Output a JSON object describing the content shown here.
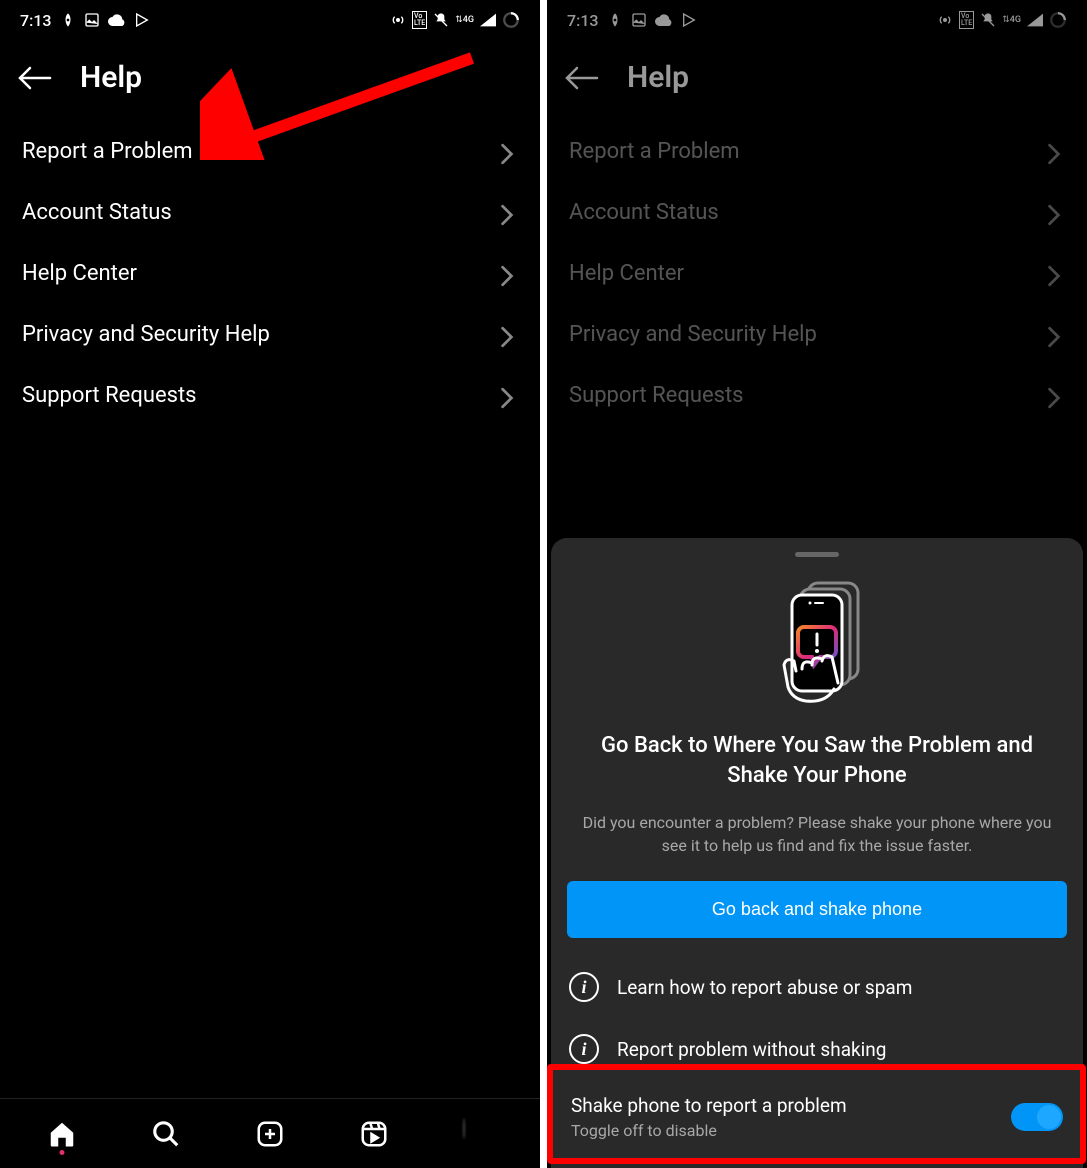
{
  "status": {
    "time": "7:13",
    "network_label": "4G"
  },
  "header": {
    "title": "Help"
  },
  "menu": {
    "items": [
      {
        "label": "Report a Problem"
      },
      {
        "label": "Account Status"
      },
      {
        "label": "Help Center"
      },
      {
        "label": "Privacy and Security Help"
      },
      {
        "label": "Support Requests"
      }
    ]
  },
  "sheet": {
    "title": "Go Back to Where You Saw the Problem and Shake Your Phone",
    "description": "Did you encounter a problem? Please shake your phone where you see it to help us find and fix the issue faster.",
    "primary_button": "Go back and shake phone",
    "learn_label": "Learn how to report abuse or spam",
    "report_label": "Report problem without shaking",
    "toggle_label": "Shake phone to report a problem",
    "toggle_sub": "Toggle off to disable"
  },
  "colors": {
    "accent": "#0095f6",
    "annotation": "#f00"
  }
}
